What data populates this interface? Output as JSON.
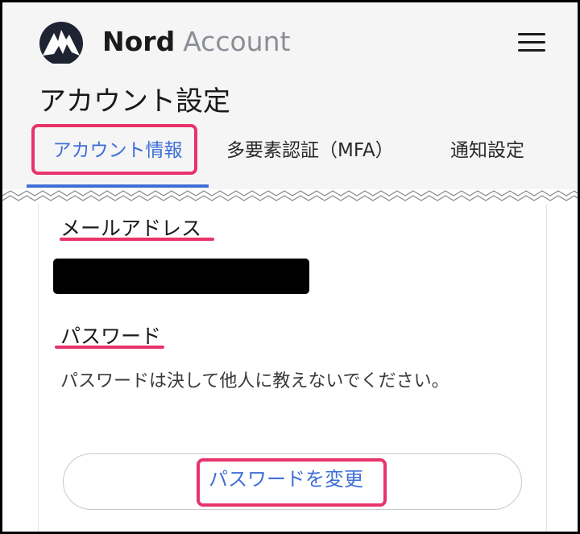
{
  "header": {
    "brand_main": "Nord",
    "brand_sub": "Account",
    "logo_icon": "nord-mountain-logo-icon",
    "menu_icon": "hamburger-menu-icon"
  },
  "page": {
    "title": "アカウント設定"
  },
  "tabs": [
    {
      "label": "アカウント情報",
      "active": true
    },
    {
      "label": "多要素認証（MFA）",
      "active": false
    },
    {
      "label": "通知設定",
      "active": false
    }
  ],
  "account": {
    "email_label": "メールアドレス",
    "password_label": "パスワード",
    "password_hint": "パスワードは決して他人に教えないでください。",
    "change_password_button": "パスワードを変更"
  },
  "colors": {
    "accent_blue": "#3e6fd6",
    "highlight_pink": "#e8336b",
    "header_bg": "#f5f5f6",
    "brand_sub_gray": "#8b8e95"
  }
}
